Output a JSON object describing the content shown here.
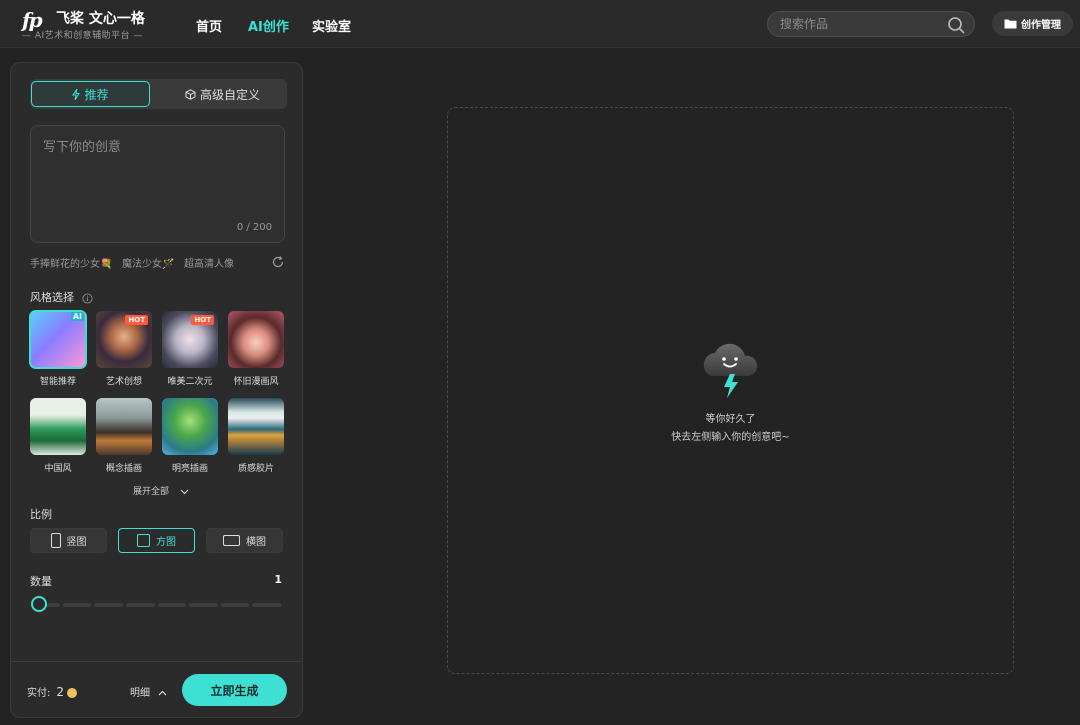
{
  "brand": {
    "mark": "fp",
    "title": "飞桨 文心一格",
    "subtitle": "— AI艺术和创意辅助平台 —"
  },
  "nav": [
    {
      "label": "首页",
      "active": false
    },
    {
      "label": "AI创作",
      "active": true
    },
    {
      "label": "实验室",
      "active": false
    }
  ],
  "search": {
    "placeholder": "搜索作品"
  },
  "manage_button": "创作管理",
  "mode_tabs": [
    {
      "label": "推荐",
      "icon": "lightning-icon",
      "active": true
    },
    {
      "label": "高级自定义",
      "icon": "cube-icon",
      "active": false
    }
  ],
  "prompt": {
    "placeholder": "写下你的创意",
    "counter": "0 / 200"
  },
  "suggestions": [
    "手捧鲜花的少女💐",
    "魔法少女🪄",
    "超高清人像"
  ],
  "style_section": {
    "label": "风格选择"
  },
  "styles": [
    {
      "name": "智能推荐",
      "badge": "AI",
      "selected": true
    },
    {
      "name": "艺术创想",
      "badge": "HOT",
      "selected": false
    },
    {
      "name": "唯美二次元",
      "badge": "HOT",
      "selected": false
    },
    {
      "name": "怀旧漫画风",
      "badge": "",
      "selected": false
    },
    {
      "name": "中国风",
      "badge": "",
      "selected": false
    },
    {
      "name": "概念插画",
      "badge": "",
      "selected": false
    },
    {
      "name": "明亮插画",
      "badge": "",
      "selected": false
    },
    {
      "name": "质感胶片",
      "badge": "",
      "selected": false
    }
  ],
  "expand_all": "展开全部",
  "ratio": {
    "label": "比例",
    "options": [
      {
        "label": "竖图",
        "active": false
      },
      {
        "label": "方图",
        "active": true
      },
      {
        "label": "横图",
        "active": false
      }
    ]
  },
  "quantity": {
    "label": "数量",
    "value": "1",
    "steps": 8
  },
  "footer": {
    "cost_label": "实付:",
    "cost_value": "2",
    "detail_label": "明细",
    "generate_label": "立即生成"
  },
  "empty_state": {
    "line1": "等你好久了",
    "line2": "快去左侧输入你的创意吧~"
  },
  "colors": {
    "accent": "#3de0d2",
    "hot": "#ff5a3c"
  }
}
